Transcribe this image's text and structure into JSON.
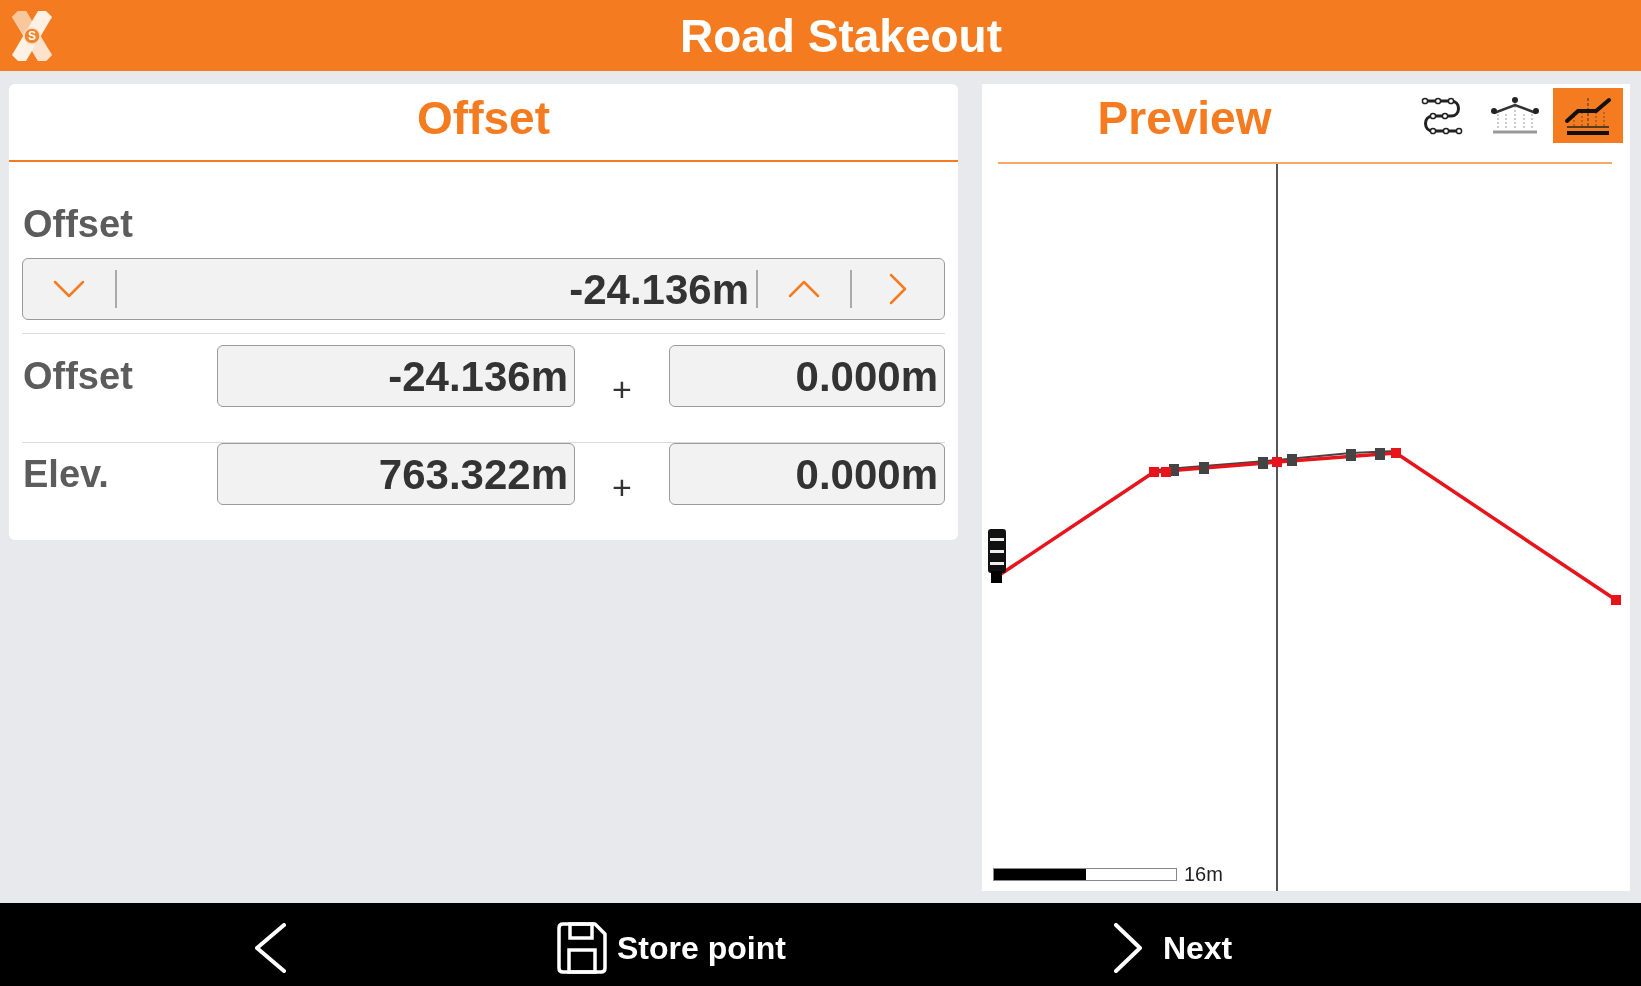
{
  "app_bar": {
    "logo_letter": "S",
    "title": "Road Stakeout"
  },
  "offset_panel": {
    "title": "Offset",
    "selector": {
      "label": "Offset",
      "value": "-24.136m"
    },
    "rows": [
      {
        "label": "Offset",
        "value": "-24.136m",
        "operator": "+",
        "adjustment": "0.000m"
      },
      {
        "label": "Elev.",
        "value": "763.322m",
        "operator": "+",
        "adjustment": "0.000m"
      }
    ]
  },
  "preview_panel": {
    "title": "Preview",
    "view_buttons": [
      {
        "kind": "alignment",
        "selected": false
      },
      {
        "kind": "cross_section",
        "selected": false
      },
      {
        "kind": "profile",
        "selected": true
      }
    ],
    "scale_label": "16m"
  },
  "bottom_bar": {
    "actions": [
      {
        "kind": "back"
      },
      {
        "kind": "store",
        "label": "Store point"
      },
      {
        "kind": "next",
        "label": "Next"
      }
    ]
  }
}
